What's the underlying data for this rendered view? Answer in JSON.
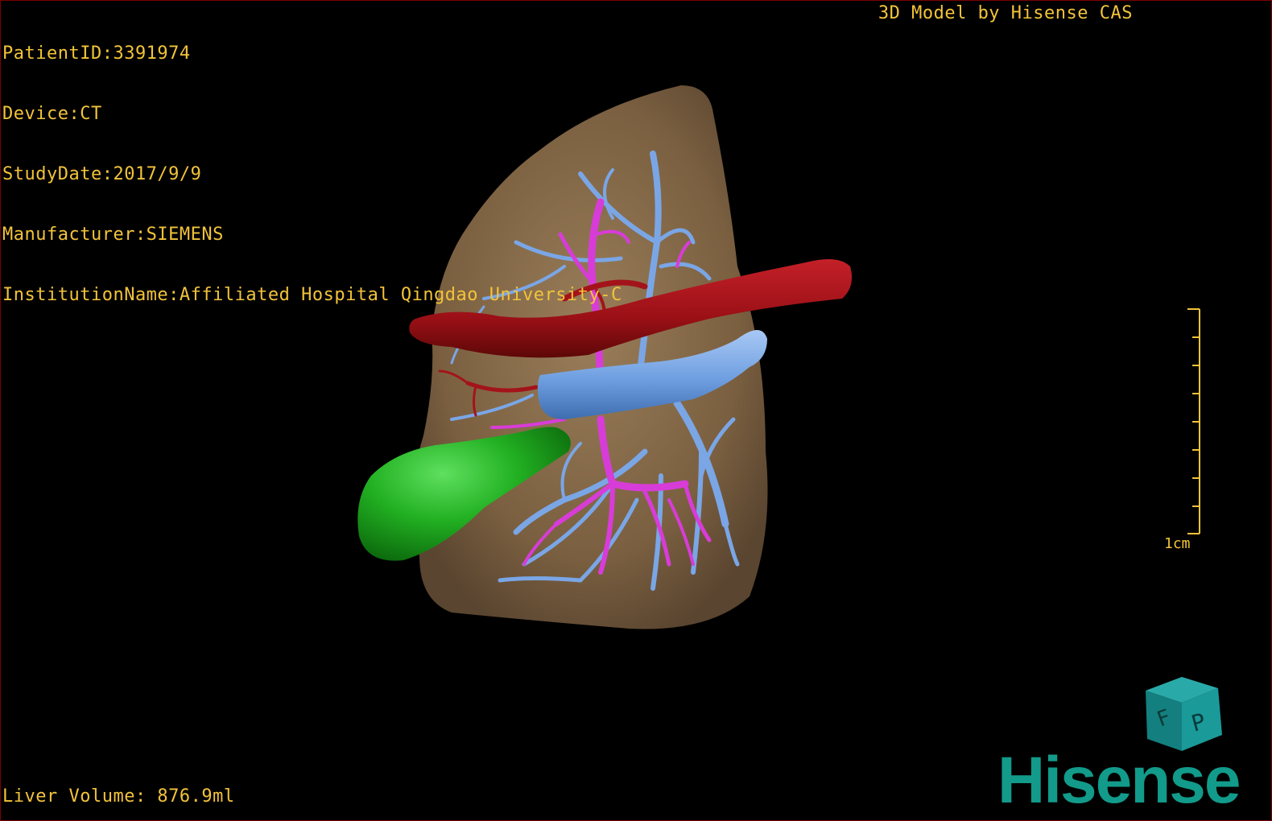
{
  "overlay": {
    "patient_id": "PatientID:3391974",
    "device": "Device:CT",
    "study_date": "StudyDate:2017/9/9",
    "manufacturer": "Manufacturer:SIEMENS",
    "institution": "InstitutionName:Affiliated Hospital Qingdao University-C",
    "brand_text": "3D Model by Hisense CAS",
    "liver_volume": "Liver Volume: 876.9ml"
  },
  "scale_bar": {
    "label": "1cm"
  },
  "orientation_cube": {
    "icon": "orientation-cube-icon",
    "face_labels": [
      "F",
      "P"
    ]
  },
  "logo": {
    "text": "Hisense"
  },
  "colors": {
    "overlay_text": "#f2c33a",
    "liver": "#8a6f4e",
    "artery": "#a3141a",
    "portal_vein": "#6f9fe0",
    "hepatic_vein": "#d63ad6",
    "gallbladder": "#1fa81f",
    "logo": "#129a8a"
  }
}
